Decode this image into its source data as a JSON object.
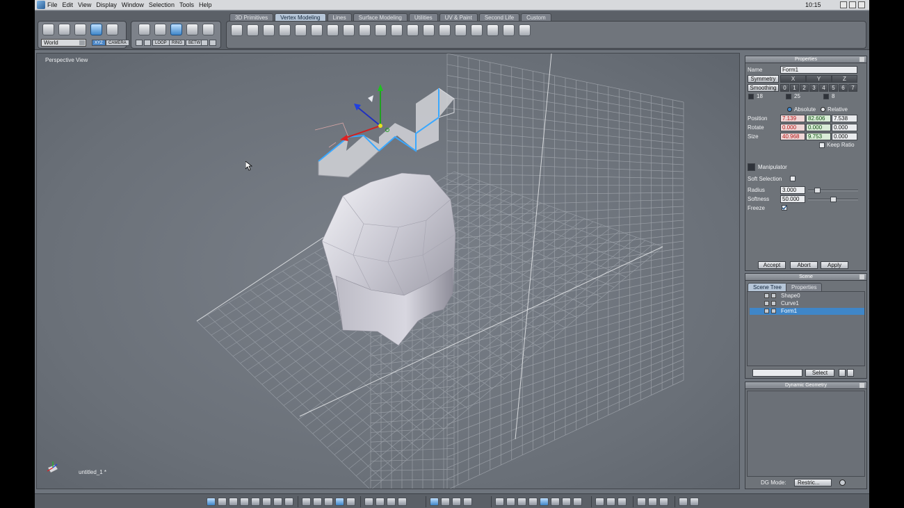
{
  "menubar": {
    "items": [
      "File",
      "Edit",
      "View",
      "Display",
      "Window",
      "Selection",
      "Tools",
      "Help"
    ],
    "clock": "10:15"
  },
  "toolbar": {
    "tabs": [
      "3D Primitives",
      "Vertex Modeling",
      "Lines",
      "Surface Modeling",
      "Utilities",
      "UV & Paint",
      "Second Life",
      "Custom"
    ],
    "active_tab": "Vertex Modeling",
    "coord_space": "World",
    "xyz_label": "XYZ",
    "camera_label": "CAMERA",
    "loop_label": "LOOP",
    "ring_label": "RING",
    "betw_label": "BETW"
  },
  "viewport": {
    "title": "Perspective View",
    "file_name": "untitled_1 *"
  },
  "properties": {
    "title": "Properties",
    "name_label": "Name",
    "name_value": "Form1",
    "symmetry_label": "Symmetry",
    "axes": [
      "X",
      "Y",
      "Z"
    ],
    "smoothing_label": "Smoothing",
    "smoothing_levels": [
      "0",
      "1",
      "2",
      "3",
      "4",
      "5",
      "6",
      "7"
    ],
    "counts": [
      "18",
      "25",
      "8"
    ],
    "absolute_label": "Absolute",
    "relative_label": "Relative",
    "position_label": "Position",
    "position": [
      "7.139",
      "82.606",
      "7.538"
    ],
    "rotate_label": "Rotate",
    "rotate": [
      "0.000",
      "0.000",
      "0.000"
    ],
    "size_label": "Size",
    "size": [
      "40.968",
      "9.753",
      "0.000"
    ],
    "keep_ratio_label": "Keep Ratio",
    "manipulator_label": "Manipulator",
    "soft_selection_label": "Soft Selection",
    "radius_label": "Radius",
    "radius_value": "3.000",
    "radius_level": 0.15,
    "softness_label": "Softness",
    "softness_value": "50.000",
    "softness_level": 0.5,
    "freeze_label": "Freeze",
    "accept_label": "Accept",
    "abort_label": "Abort",
    "apply_label": "Apply"
  },
  "scene": {
    "title": "Scene",
    "tabs": [
      "Scene Tree",
      "Properties"
    ],
    "items": [
      "Shape0",
      "Curve1",
      "Form1"
    ],
    "selected_item": "Form1",
    "select_label": "Select"
  },
  "dynamic_geometry": {
    "title": "Dynamic Geometry",
    "dg_mode_label": "DG Mode:",
    "dg_mode_value": "Restric..."
  }
}
